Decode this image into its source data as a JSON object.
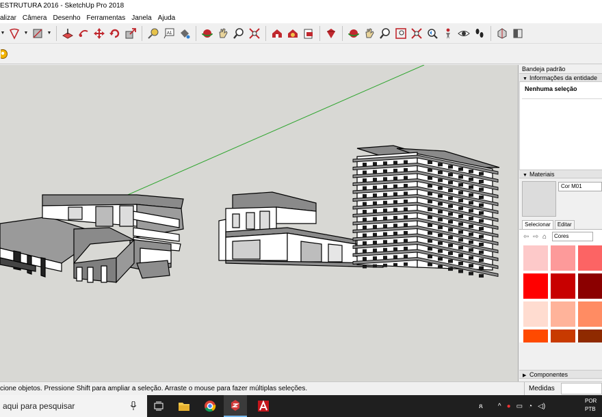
{
  "window": {
    "title": "ESTRUTURA 2016 - SketchUp Pro 2018"
  },
  "menu": [
    "alizar",
    "Câmera",
    "Desenho",
    "Ferramentas",
    "Janela",
    "Ajuda"
  ],
  "toolbar": {
    "icons": [
      "dropdown-arrow",
      "lasso-draw-icon",
      "dropdown-arrow",
      "rectangle-icon",
      "dropdown-arrow",
      "push-pull-icon",
      "follow-me-icon",
      "move-icon",
      "rotate-icon",
      "scale-icon",
      "tape-measure-icon",
      "text-icon",
      "paint-bucket-icon",
      "orbit-icon",
      "pan-icon",
      "zoom-icon",
      "zoom-extents-icon",
      "warehouse-icon",
      "extension-warehouse-icon",
      "send-to-layout-icon",
      "extension-manager-icon",
      "orbit-icon",
      "pan-icon",
      "zoom-icon",
      "zoom-window-icon",
      "zoom-extents-icon",
      "previous-view-icon",
      "position-camera-icon",
      "look-around-icon",
      "walk-icon",
      "section-plane-icon",
      "section-display-icon"
    ]
  },
  "tray": {
    "title": "Bandeja padrão",
    "entity_info": {
      "header": "Informações da entidade",
      "selection": "Nenhuma seleção"
    },
    "materials": {
      "header": "Materiais",
      "material_name": "Cor M01",
      "tabs": [
        "Selecionar",
        "Editar"
      ],
      "collection": "Cores",
      "swatch_colors": [
        [
          "#fdc9c9",
          "#fd9a9a",
          "#fc6464"
        ],
        [
          "#ff0000",
          "#c80000",
          "#8b0000"
        ],
        [
          "#ffdcd0",
          "#ffb39a",
          "#ff8c63"
        ],
        [
          "#ff4a00",
          "#c83a00",
          "#8f2a00"
        ]
      ]
    },
    "components": {
      "header": "Componentes"
    }
  },
  "statusbar": {
    "hint": "cione objetos. Pressione Shift para ampliar a seleção. Arraste o mouse para fazer múltiplas seleções.",
    "measure_label": "Medidas",
    "measure_value": ""
  },
  "taskbar": {
    "search_placeholder": "aqui para pesquisar",
    "apps": [
      "task-view-icon",
      "file-explorer-icon",
      "chrome-icon",
      "sketchup-icon",
      "autocad-icon"
    ],
    "active_app": "sketchup-icon",
    "language": [
      "POR",
      "PTB"
    ]
  },
  "colors": {
    "viewport_bg": "#d8d8d4",
    "green_axis": "#2fa52f",
    "building_wall": "#ffffff",
    "building_roof": "#8c8c8c"
  }
}
